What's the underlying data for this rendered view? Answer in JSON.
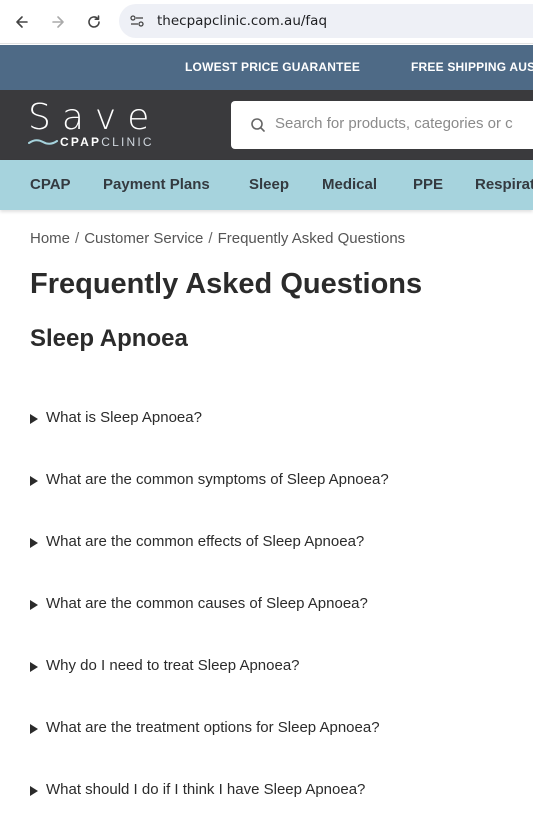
{
  "browser": {
    "url": "thecpapclinic.com.au/faq"
  },
  "promo": {
    "items": [
      "LOWEST PRICE GUARANTEE",
      "FREE SHIPPING AUS"
    ]
  },
  "header": {
    "logo_top": "Save",
    "logo_cpap": "CPAP",
    "logo_clinic": "CLINIC",
    "search_placeholder": "Search for products, categories or c"
  },
  "categories": [
    "CPAP",
    "Payment Plans",
    "Sleep",
    "Medical",
    "PPE",
    "Respirat"
  ],
  "breadcrumb": [
    "Home",
    "Customer Service",
    "Frequently Asked Questions"
  ],
  "breadcrumb_separator": "/",
  "page_title": "Frequently Asked Questions",
  "section_title": "Sleep Apnoea",
  "faqs": [
    "What is Sleep Apnoea?",
    "What are the common symptoms of Sleep Apnoea?",
    "What are the common effects of Sleep Apnoea?",
    "What are the common causes of Sleep Apnoea?",
    "Why do I need to treat Sleep Apnoea?",
    "What are the treatment options for Sleep Apnoea?",
    "What should I do if I think I have Sleep Apnoea?"
  ],
  "colors": {
    "promo_bg": "#4e6a86",
    "header_bg": "#3a3a3d",
    "category_bg": "#a6d3dd"
  },
  "icons": [
    "back-arrow-icon",
    "forward-arrow-icon",
    "reload-icon",
    "site-info-icon",
    "search-icon",
    "disclosure-triangle-icon"
  ]
}
